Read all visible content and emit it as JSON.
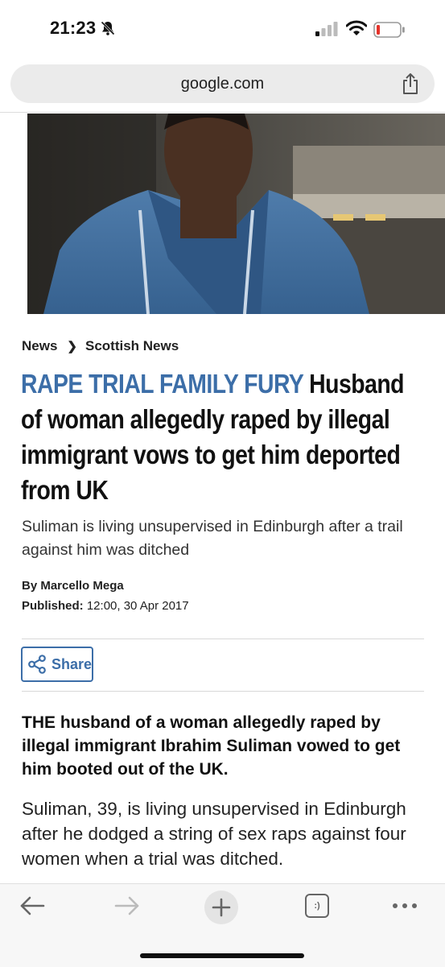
{
  "status_bar": {
    "time": "21:23"
  },
  "browser": {
    "url": "google.com"
  },
  "article": {
    "breadcrumb": {
      "section": "News",
      "subsection": "Scottish News"
    },
    "headline_kicker": "RAPE TRIAL FAMILY FURY",
    "headline_rest": " Husband of woman allegedly raped by illegal immigrant vows to get him deported from UK",
    "standfirst": "Suliman is living unsupervised in Edinburgh after a trail against him was ditched",
    "byline": "By Marcello Mega",
    "published_label": "Published:",
    "published_value": " 12:00, 30 Apr 2017",
    "share_label": "Share",
    "lede": "THE husband of a woman allegedly raped by illegal immigrant Ibrahim Suliman vowed to get him booted out of the UK.",
    "body_paragraph": "Suliman, 39, is living unsupervised in Edinburgh after he dodged a string of sex raps against four women when a trial was ditched."
  },
  "toolbar": {
    "tabs_icon_glyph": ":)"
  },
  "colors": {
    "accent": "#3c6ea8",
    "url_bar_bg": "#ebebeb",
    "toolbar_bg": "#f7f7f7"
  }
}
